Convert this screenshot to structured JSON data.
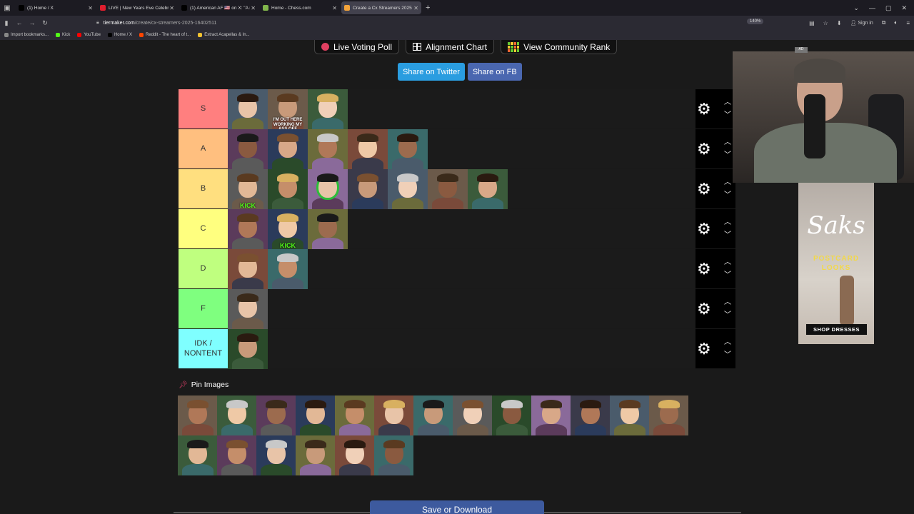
{
  "browser": {
    "tabs": [
      {
        "label": "(1) Home / X",
        "color": "#000000",
        "active": false
      },
      {
        "label": "LIVE | New Years Eve Celebratio",
        "color": "#e01e2e",
        "active": false
      },
      {
        "label": "(1) American AF 🇺🇸 on X: \"A m",
        "color": "#000000",
        "active": false
      },
      {
        "label": "Home - Chess.com",
        "color": "#81b64c",
        "active": false
      },
      {
        "label": "Create a Cx Streamers 2025 Tie",
        "color": "#f2a33a",
        "active": true
      }
    ],
    "url_host": "tiermaker.com",
    "url_path": "/create/cx-streamers-2025-16402511",
    "zoom": "140%",
    "sign_in": "Sign in",
    "bookmarks": [
      {
        "label": "Import bookmarks...",
        "color": "#888888"
      },
      {
        "label": "Kick",
        "color": "#53fc18"
      },
      {
        "label": "YouTube",
        "color": "#ff0000"
      },
      {
        "label": "Home / X",
        "color": "#000000"
      },
      {
        "label": "Reddit - The heart of t...",
        "color": "#ff4500"
      },
      {
        "label": "Extract Acapellas & In...",
        "color": "#f2c230"
      }
    ]
  },
  "top_buttons": {
    "poll": "Live Voting Poll",
    "alignment": "Alignment Chart",
    "rank": "View Community Rank"
  },
  "share": {
    "twitter": "Share on Twitter",
    "fb": "Share on FB"
  },
  "tiers": [
    {
      "label": "S",
      "color": "#ff7f7f",
      "count": 3,
      "captions": {
        "1": "I'M OUT HERE WORKING MY ASS OFF"
      }
    },
    {
      "label": "A",
      "color": "#ffbf7f",
      "count": 5,
      "captions": {}
    },
    {
      "label": "B",
      "color": "#ffdf7f",
      "count": 7,
      "captions": {},
      "kick": [
        0
      ],
      "ring": [
        2
      ]
    },
    {
      "label": "C",
      "color": "#ffff7f",
      "count": 3,
      "captions": {},
      "kick": [
        1
      ]
    },
    {
      "label": "D",
      "color": "#bfff7f",
      "count": 2,
      "captions": {}
    },
    {
      "label": "F",
      "color": "#7fff7f",
      "count": 1,
      "captions": {}
    },
    {
      "label": "IDK / NONTENT",
      "color": "#7fffff",
      "count": 1,
      "captions": {}
    }
  ],
  "kick_caption": "KICK",
  "pin": {
    "title": "Pin Images",
    "count": 19
  },
  "save_label": "Save or Download",
  "ad": {
    "brand": "Saks",
    "tagline": "POSTCARD LOOKS",
    "cta": "SHOP DRESSES",
    "badge": "AD"
  }
}
